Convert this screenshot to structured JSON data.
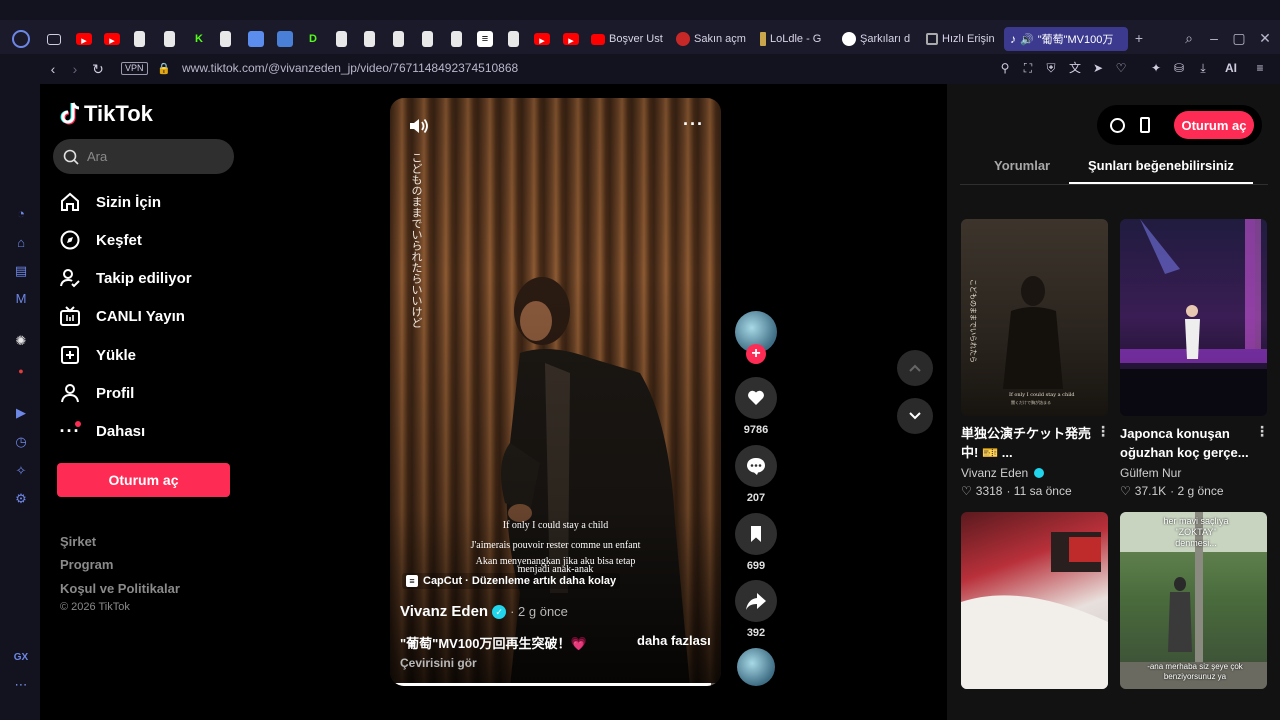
{
  "browser": {
    "tabs_labeled": [
      {
        "label": "Boşver Ust",
        "color": "#ff0000"
      },
      {
        "label": "Sakın açm",
        "color": "#c62828"
      },
      {
        "label": "LoLdle - G",
        "color": "#c9a64b"
      },
      {
        "label": "Şarkıları d",
        "color": "#ffffff"
      },
      {
        "label": "Hızlı Erişin",
        "color": "#777777"
      }
    ],
    "active_tab": "\"葡萄\"MV100万",
    "url": "www.tiktok.com/@vivanzeden_jp/video/7671148492374510868",
    "vpn": "VPN",
    "ai_label": "AI"
  },
  "tiktok": {
    "logo": "TikTok",
    "search_placeholder": "Ara",
    "nav": [
      {
        "label": "Sizin İçin",
        "icon": "home-icon"
      },
      {
        "label": "Keşfet",
        "icon": "compass-icon"
      },
      {
        "label": "Takip ediliyor",
        "icon": "following-icon"
      },
      {
        "label": "CANLI Yayın",
        "icon": "live-icon"
      },
      {
        "label": "Yükle",
        "icon": "upload-icon"
      },
      {
        "label": "Profil",
        "icon": "profile-icon"
      },
      {
        "label": "Dahası",
        "icon": "more-icon"
      }
    ],
    "login_label": "Oturum aç",
    "footer": [
      "Şirket",
      "Program",
      "Koşul ve Politikalar"
    ],
    "copyright": "© 2026 TikTok"
  },
  "video": {
    "vertical_text": "こどものままでいられたらいいけど",
    "subtitles": [
      "If only I could stay a child",
      "J'aimerais pouvoir rester comme un enfant",
      "Akan menyenangkan jika aku bisa tetap",
      "menjadi anak-anak"
    ],
    "capcut": "CapCut · Düzenleme artık daha kolay",
    "author": "Vivanz Eden",
    "time": "· 2 g önce",
    "caption": "\"葡萄\"MV100万回再生突破！💗",
    "more": "daha fazlası",
    "translate": "Çevirisini gör",
    "progress": 0.97
  },
  "actions": {
    "likes": "9786",
    "comments": "207",
    "saves": "699",
    "shares": "392"
  },
  "right_panel": {
    "login": "Oturum aç",
    "tabs": [
      "Yorumlar",
      "Şunları beğenebilirsiniz"
    ],
    "cards": [
      {
        "title": "単独公演チケット発売中! 🎫 ...",
        "author": "Vivanz Eden",
        "verified": true,
        "likes": "3318",
        "time": "· 11 sa önce"
      },
      {
        "title": "Japonca konuşan oğuzhan koç gerçe...",
        "author": "Gülfem Nur",
        "verified": false,
        "likes": "37.1K",
        "time": "· 2 g önce"
      },
      {
        "overlay": ""
      },
      {
        "overlay": "her mavi saçlıya \"ZOKTAY\" denmesi...",
        "overlay2": "-ana merhaba siz şeye çok benziyorsunuz ya"
      }
    ]
  },
  "colors": {
    "accent": "#fe2c55",
    "verified": "#20d5ec",
    "active_tab": "#3b3a8e"
  }
}
